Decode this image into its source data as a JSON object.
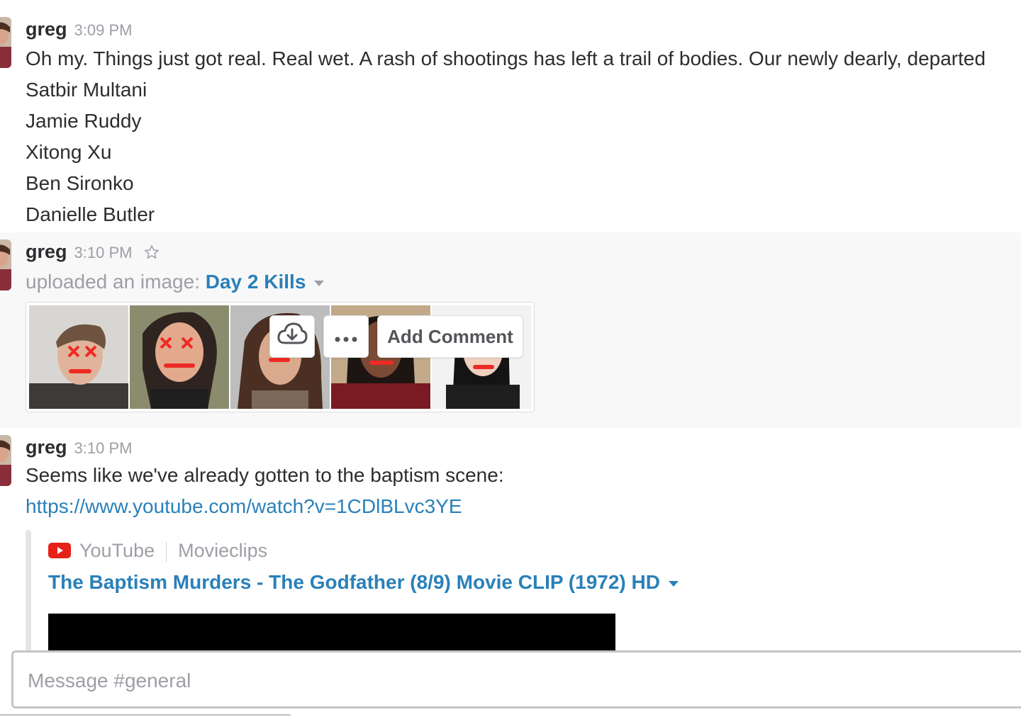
{
  "messages": [
    {
      "sender": "greg",
      "time": "3:09 PM",
      "text": "Oh my.  Things just got real.  Real wet.   A rash of shootings has left a trail of bodies.  Our newly dearly, departed",
      "names": [
        "Satbir Multani",
        "Jamie Ruddy",
        "Xitong Xu",
        "Ben Sironko",
        "Danielle Butler"
      ]
    },
    {
      "sender": "greg",
      "time": "3:10 PM",
      "upload_prefix": "uploaded an image:",
      "file_name": "Day 2 Kills",
      "actions": {
        "download_icon": "cloud-download-icon",
        "more_icon": "more-icon",
        "add_comment": "Add Comment"
      }
    },
    {
      "sender": "greg",
      "time": "3:10 PM",
      "text": "Seems like we've already gotten to the baptism scene:",
      "link": "https://www.youtube.com/watch?v=1CDlBLvc3YE",
      "embed": {
        "service": "YouTube",
        "author": "Movieclips",
        "title": "The Baptism Murders - The Godfather (8/9) Movie CLIP (1972) HD"
      }
    }
  ],
  "composer": {
    "placeholder": "Message #general"
  },
  "colors": {
    "link": "#2a80b9",
    "muted": "#9e9ea6",
    "text": "#2c2d30",
    "hover_bg": "#f8f8f8",
    "youtube_red": "#e62117"
  }
}
